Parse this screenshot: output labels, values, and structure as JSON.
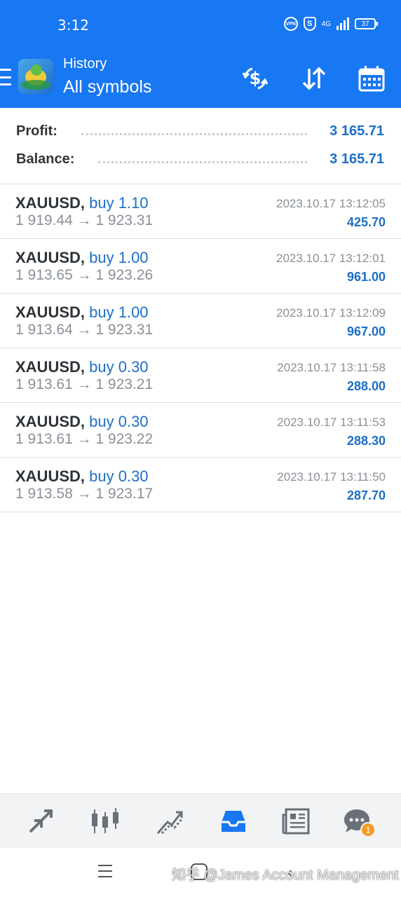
{
  "status_bar": {
    "time": "3:12",
    "vpn": "VPN",
    "shield": "S",
    "network": "4G",
    "battery": "37"
  },
  "app_bar": {
    "subtitle": "History",
    "title": "All symbols",
    "icons": [
      "menu-icon",
      "app-logo",
      "currency-exchange-icon",
      "sort-icon",
      "calendar-icon"
    ]
  },
  "summary": {
    "profit_label": "Profit:",
    "profit_value": "3 165.71",
    "balance_label": "Balance:",
    "balance_value": "3 165.71"
  },
  "trades": [
    {
      "symbol": "XAUUSD,",
      "direction": "buy 1.10",
      "prices": "1 919.44 → 1 923.31",
      "time": "2023.10.17 13:12:05",
      "profit": "425.70"
    },
    {
      "symbol": "XAUUSD,",
      "direction": "buy 1.00",
      "prices": "1 913.65 → 1 923.26",
      "time": "2023.10.17 13:12:01",
      "profit": "961.00"
    },
    {
      "symbol": "XAUUSD,",
      "direction": "buy 1.00",
      "prices": "1 913.64 → 1 923.31",
      "time": "2023.10.17 13:12:09",
      "profit": "967.00"
    },
    {
      "symbol": "XAUUSD,",
      "direction": "buy 0.30",
      "prices": "1 913.61 → 1 923.21",
      "time": "2023.10.17 13:11:58",
      "profit": "288.00"
    },
    {
      "symbol": "XAUUSD,",
      "direction": "buy 0.30",
      "prices": "1 913.61 → 1 923.22",
      "time": "2023.10.17 13:11:53",
      "profit": "288.30"
    },
    {
      "symbol": "XAUUSD,",
      "direction": "buy 0.30",
      "prices": "1 913.58 → 1 923.17",
      "time": "2023.10.17 13:11:50",
      "profit": "287.70"
    }
  ],
  "bottom_nav": {
    "items": [
      "quotes-icon",
      "chart-icon",
      "trade-icon",
      "history-icon",
      "news-icon",
      "chat-icon"
    ],
    "active": "history-icon",
    "chat_badge": "1"
  },
  "watermark": "知乎 @James Account Management",
  "colors": {
    "primary": "#1877f2",
    "accent_text": "#1d6fc6",
    "muted_text": "#8a9097",
    "badge": "#f59a23"
  }
}
